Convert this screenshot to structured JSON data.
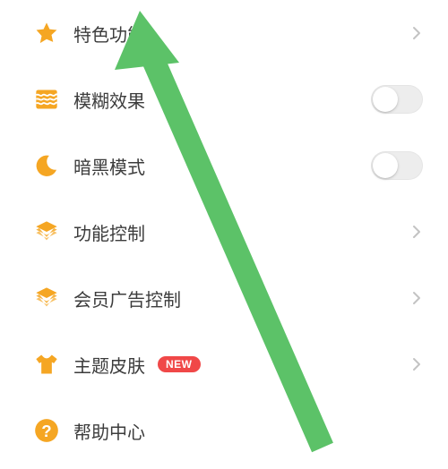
{
  "accent_color": "#f5a623",
  "badge_color": "#f04848",
  "arrow_color": "#5cc268",
  "items": [
    {
      "icon": "star",
      "label": "特色功能",
      "right": "chevron"
    },
    {
      "icon": "waves",
      "label": "模糊效果",
      "right": "toggle"
    },
    {
      "icon": "moon",
      "label": "暗黑模式",
      "right": "toggle"
    },
    {
      "icon": "layers",
      "label": "功能控制",
      "right": "chevron"
    },
    {
      "icon": "layers",
      "label": "会员广告控制",
      "right": "chevron"
    },
    {
      "icon": "shirt",
      "label": "主题皮肤",
      "right": "chevron",
      "badge": "NEW"
    },
    {
      "icon": "help",
      "label": "帮助中心",
      "right": "none"
    }
  ]
}
